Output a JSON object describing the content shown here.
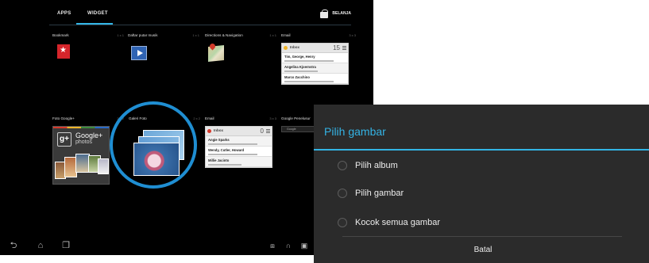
{
  "tabs": [
    {
      "label": "APPS"
    },
    {
      "label": "WIDGET"
    }
  ],
  "shop_label": "BELANJA",
  "widgets": [
    {
      "label": "Bookmark",
      "size": "1 x 1"
    },
    {
      "label": "Daftar putar musik",
      "size": "1 x 1"
    },
    {
      "label": "Directions & Navigation",
      "size": "1 x 1"
    },
    {
      "label": "Email",
      "size": "3 x 3"
    },
    {
      "label": "Foto Google+",
      "size": "2 x 2"
    },
    {
      "label": "Galeri Foto",
      "size": "2 x 2"
    },
    {
      "label": "Email",
      "size": "3 x 3"
    },
    {
      "label": "Google Penelusur",
      "size": "4 x 1"
    }
  ],
  "email_widget": {
    "title": "Inbox",
    "count": "15",
    "rows": [
      {
        "from": "Tim, George, Henry"
      },
      {
        "from": "Angelina Kjoernstra"
      },
      {
        "from": "Marco Zacchino"
      }
    ]
  },
  "email_widget_2": {
    "title": "Inbox",
    "count": "0",
    "rows": [
      {
        "from": "Angie Sparks"
      },
      {
        "from": "Wendy, Cutler, Howard"
      },
      {
        "from": "Millie Jacinto"
      }
    ]
  },
  "gplus": {
    "name": "Google+",
    "sub": "photos"
  },
  "search_hint": "Google",
  "dialog": {
    "title": "Pilih gambar",
    "options": [
      "Pilih album",
      "Pilih gambar",
      "Kocok semua gambar"
    ],
    "cancel": "Batal"
  },
  "colors": {
    "accent": "#33b5e5",
    "dialog_bg": "#2b2b2b",
    "highlight_ring": "#1f8ed2"
  },
  "icons": {
    "nav": [
      "back-icon",
      "home-icon",
      "recent-apps-icon"
    ],
    "status": [
      "screenshot-icon",
      "headphones-icon",
      "gallery-icon"
    ]
  }
}
